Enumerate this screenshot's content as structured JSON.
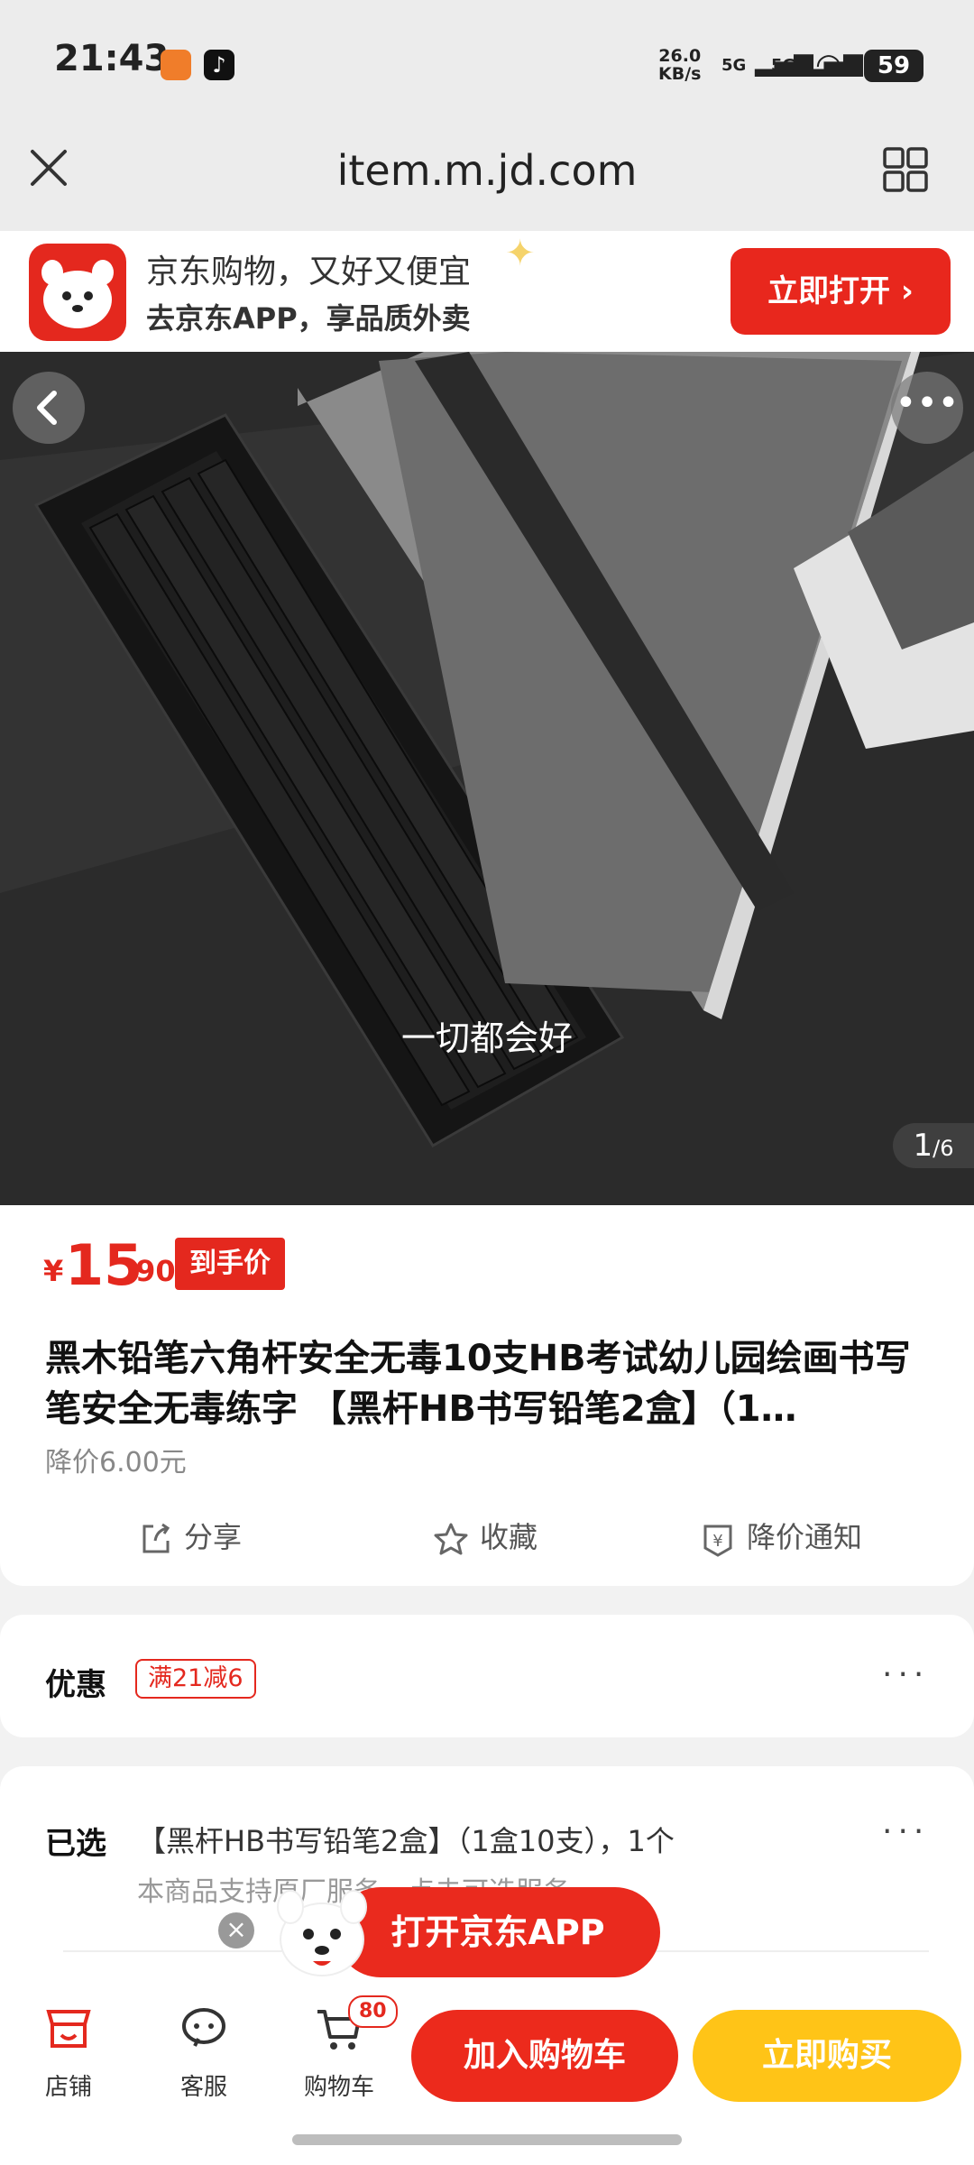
{
  "status_bar": {
    "time": "21:43",
    "net_speed_value": "26.0",
    "net_speed_unit": "KB/s",
    "signal1": "5G",
    "signal2": "5G",
    "battery": "59"
  },
  "browser": {
    "url": "item.m.jd.com"
  },
  "banner": {
    "line1": "京东购物，又好又便宜",
    "line2": "去京东APP，享品质外卖",
    "open_button": "立即打开"
  },
  "gallery": {
    "subtitle": "一切都会好",
    "page_current": "1",
    "page_total": "/6"
  },
  "product": {
    "price_symbol": "¥",
    "price_integer": "15",
    "price_decimal": ".90",
    "price_tag": "到手价",
    "title": "黑木铅笔六角杆安全无毒10支HB考试幼儿园绘画书写笔安全无毒练字 【黑杆HB书写铅笔2盒】（1…",
    "price_drop": "降价6.00元",
    "actions": {
      "share": "分享",
      "favorite": "收藏",
      "price_alert": "降价通知"
    }
  },
  "coupon": {
    "label": "优惠",
    "tag": "满21减6"
  },
  "selected": {
    "label": "已选",
    "value": "【黑杆HB书写铅笔2盒】（1盒10支），1个",
    "service_note": "本商品支持原厂服务，点击可选服务"
  },
  "floating": {
    "open_app": "打开京东APP"
  },
  "bottom_bar": {
    "store": "店铺",
    "service": "客服",
    "cart": "购物车",
    "cart_count": "80",
    "add_to_cart": "加入购物车",
    "buy_now": "立即购买"
  },
  "colors": {
    "brand_red": "#e4281e",
    "buy_yellow": "#ffc417"
  }
}
